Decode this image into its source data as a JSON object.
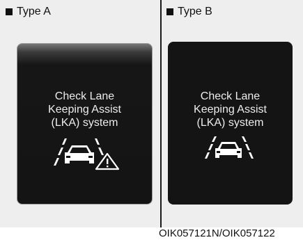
{
  "type_a": {
    "label": "Type A",
    "message": [
      "Check Lane",
      "Keeping Assist",
      "(LKA) system"
    ],
    "icon": "lane-keeping-assist-icon",
    "warning_icon": "warning-triangle-icon"
  },
  "type_b": {
    "label": "Type B",
    "message": [
      "Check Lane",
      "Keeping Assist",
      "(LKA) system"
    ],
    "icon": "lane-keeping-assist-icon"
  },
  "caption": "OIK057121N/OIK057122"
}
